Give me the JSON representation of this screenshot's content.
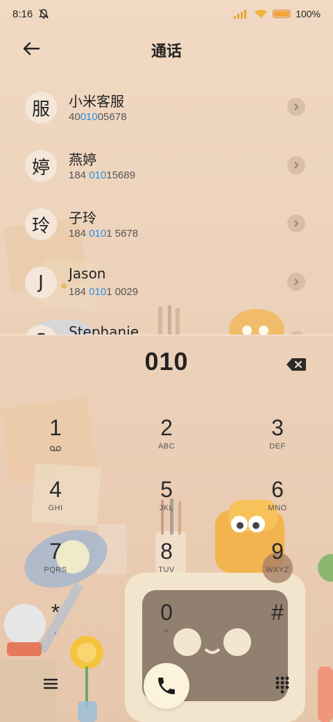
{
  "status": {
    "time": "8:16",
    "battery_percent": "100%",
    "battery_level": 1.0
  },
  "header": {
    "title": "通话"
  },
  "contacts": [
    {
      "avatar": "服",
      "name": "小米客服",
      "num_pre": "40",
      "num_hl": "010",
      "num_post": "05678"
    },
    {
      "avatar": "婷",
      "name": "燕婷",
      "num_pre": "184 ",
      "num_hl": "010",
      "num_post": "15689"
    },
    {
      "avatar": "玲",
      "name": "子玲",
      "num_pre": "184 ",
      "num_hl": "010",
      "num_post": "1 5678"
    },
    {
      "avatar": "J",
      "name": "Jason",
      "num_pre": "184 ",
      "num_hl": "010",
      "num_post": "1 0029"
    },
    {
      "avatar": "S",
      "name": "Stephanie",
      "num_pre": "",
      "num_hl": "",
      "num_post": ""
    }
  ],
  "dialer": {
    "number": "010",
    "keys": [
      {
        "digit": "1",
        "letters": ""
      },
      {
        "digit": "2",
        "letters": "ABC"
      },
      {
        "digit": "3",
        "letters": "DEF"
      },
      {
        "digit": "4",
        "letters": "GHI"
      },
      {
        "digit": "5",
        "letters": "JKL"
      },
      {
        "digit": "6",
        "letters": "MNO"
      },
      {
        "digit": "7",
        "letters": "PQRS"
      },
      {
        "digit": "8",
        "letters": "TUV"
      },
      {
        "digit": "9",
        "letters": "WXYZ"
      },
      {
        "digit": "*",
        "letters": ","
      },
      {
        "digit": "0",
        "letters": "+"
      },
      {
        "digit": "#",
        "letters": ""
      }
    ]
  },
  "icons": {
    "back": "arrow-left-icon",
    "backspace": "backspace-icon",
    "call": "phone-icon",
    "menu": "menu-icon",
    "keypad": "keypad-icon",
    "voicemail": "voicemail-icon"
  },
  "colors": {
    "highlight": "#2d8fe3",
    "call_button": "#fbf3dc"
  }
}
